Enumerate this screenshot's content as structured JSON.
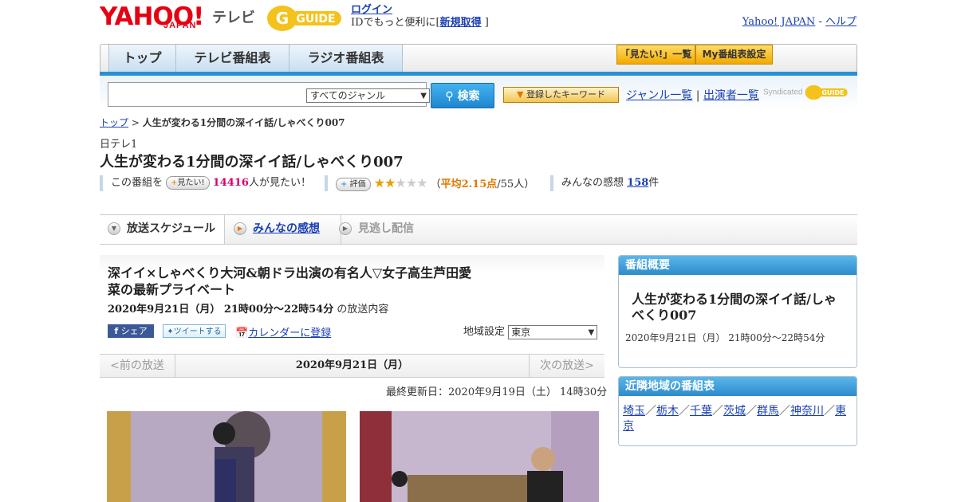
{
  "header": {
    "yahoo_logo": "YAHOO!",
    "japan_logo": "JAPAN",
    "tv_logo": "テレビ",
    "gguide_logo": "G-GUIDE",
    "login_link": "ログイン",
    "login_text": "IDでもっと便利に[",
    "register_link": "新規取得",
    "register_suffix": "]",
    "yahoo_japan_link": "Yahoo! JAPAN",
    "separator": " - ",
    "help_link": "ヘルプ"
  },
  "nav": {
    "tabs": [
      {
        "label": "トップ"
      },
      {
        "label": "テレビ番組表"
      },
      {
        "label": "ラジオ番組表"
      }
    ],
    "mitai_list_button": "「見たい!」一覧",
    "my_settings_button": "My番組表設定"
  },
  "search": {
    "genre_selected": "すべてのジャンル",
    "search_button": "検索",
    "keyword_button": "登録したキーワード",
    "genre_list_link": "ジャンル一覧",
    "link_sep": "|",
    "performer_list_link": "出演者一覧",
    "syndicated_text": "Syndicated"
  },
  "breadcrumb": {
    "home_link": "トップ",
    "sep": ">",
    "current": "人生が変わる1分間の深イイ話/しゃべくり007"
  },
  "program": {
    "station": "日テレ1",
    "title": "人生が変わる1分間の深イイ話/しゃべくり007",
    "mitai_prefix": "この番組を",
    "mitai_button": "見たい!",
    "mitai_count": "14416",
    "mitai_suffix": "人が見たい！",
    "rate_button": "評価",
    "rating_stars": 2.15,
    "rating_open": "（",
    "rating_label": "平均2.15点",
    "rating_people": "/55人）",
    "review_prefix": "みんなの感想",
    "review_count": "158",
    "review_suffix": "件"
  },
  "program_tabs": {
    "schedule": "放送スケジュール",
    "reviews": "みんなの感想",
    "streaming": "見逃し配信"
  },
  "episode": {
    "title": "深イイ×しゃべくり大河&朝ドラ出演の有名人▽女子高生芦田愛菜の最新プライベート",
    "datetime": "2020年9月21日（月） 21時00分～22時54分",
    "datetime_suffix": "の放送内容",
    "facebook_button": "シェア",
    "tweet_button": "ツイートする",
    "calendar_link": "カレンダーに登録",
    "region_label": "地域設定",
    "region_selected": "東京"
  },
  "pager": {
    "prev": "<前の放送",
    "current": "2020年9月21日（月）",
    "next": "次の放送>"
  },
  "updated": "最終更新日：2020年9月19日（土） 14時30分",
  "sidebar": {
    "overview_title": "番組概要",
    "overview_program": "人生が変わる1分間の深イイ話/しゃべくり007",
    "overview_time": "2020年9月21日（月） 21時00分～22時54分",
    "nearby_title": "近隣地域の番組表",
    "nearby_regions": [
      "埼玉",
      "栃木",
      "千葉",
      "茨城",
      "群馬",
      "神奈川",
      "東京"
    ],
    "region_sep": "／"
  },
  "colors": {
    "accent_blue": "#2a8fd5",
    "link": "#1a3fb3",
    "brand_red": "#e60012",
    "mitai_pink": "#d8006b",
    "rating_orange": "#e07800"
  }
}
